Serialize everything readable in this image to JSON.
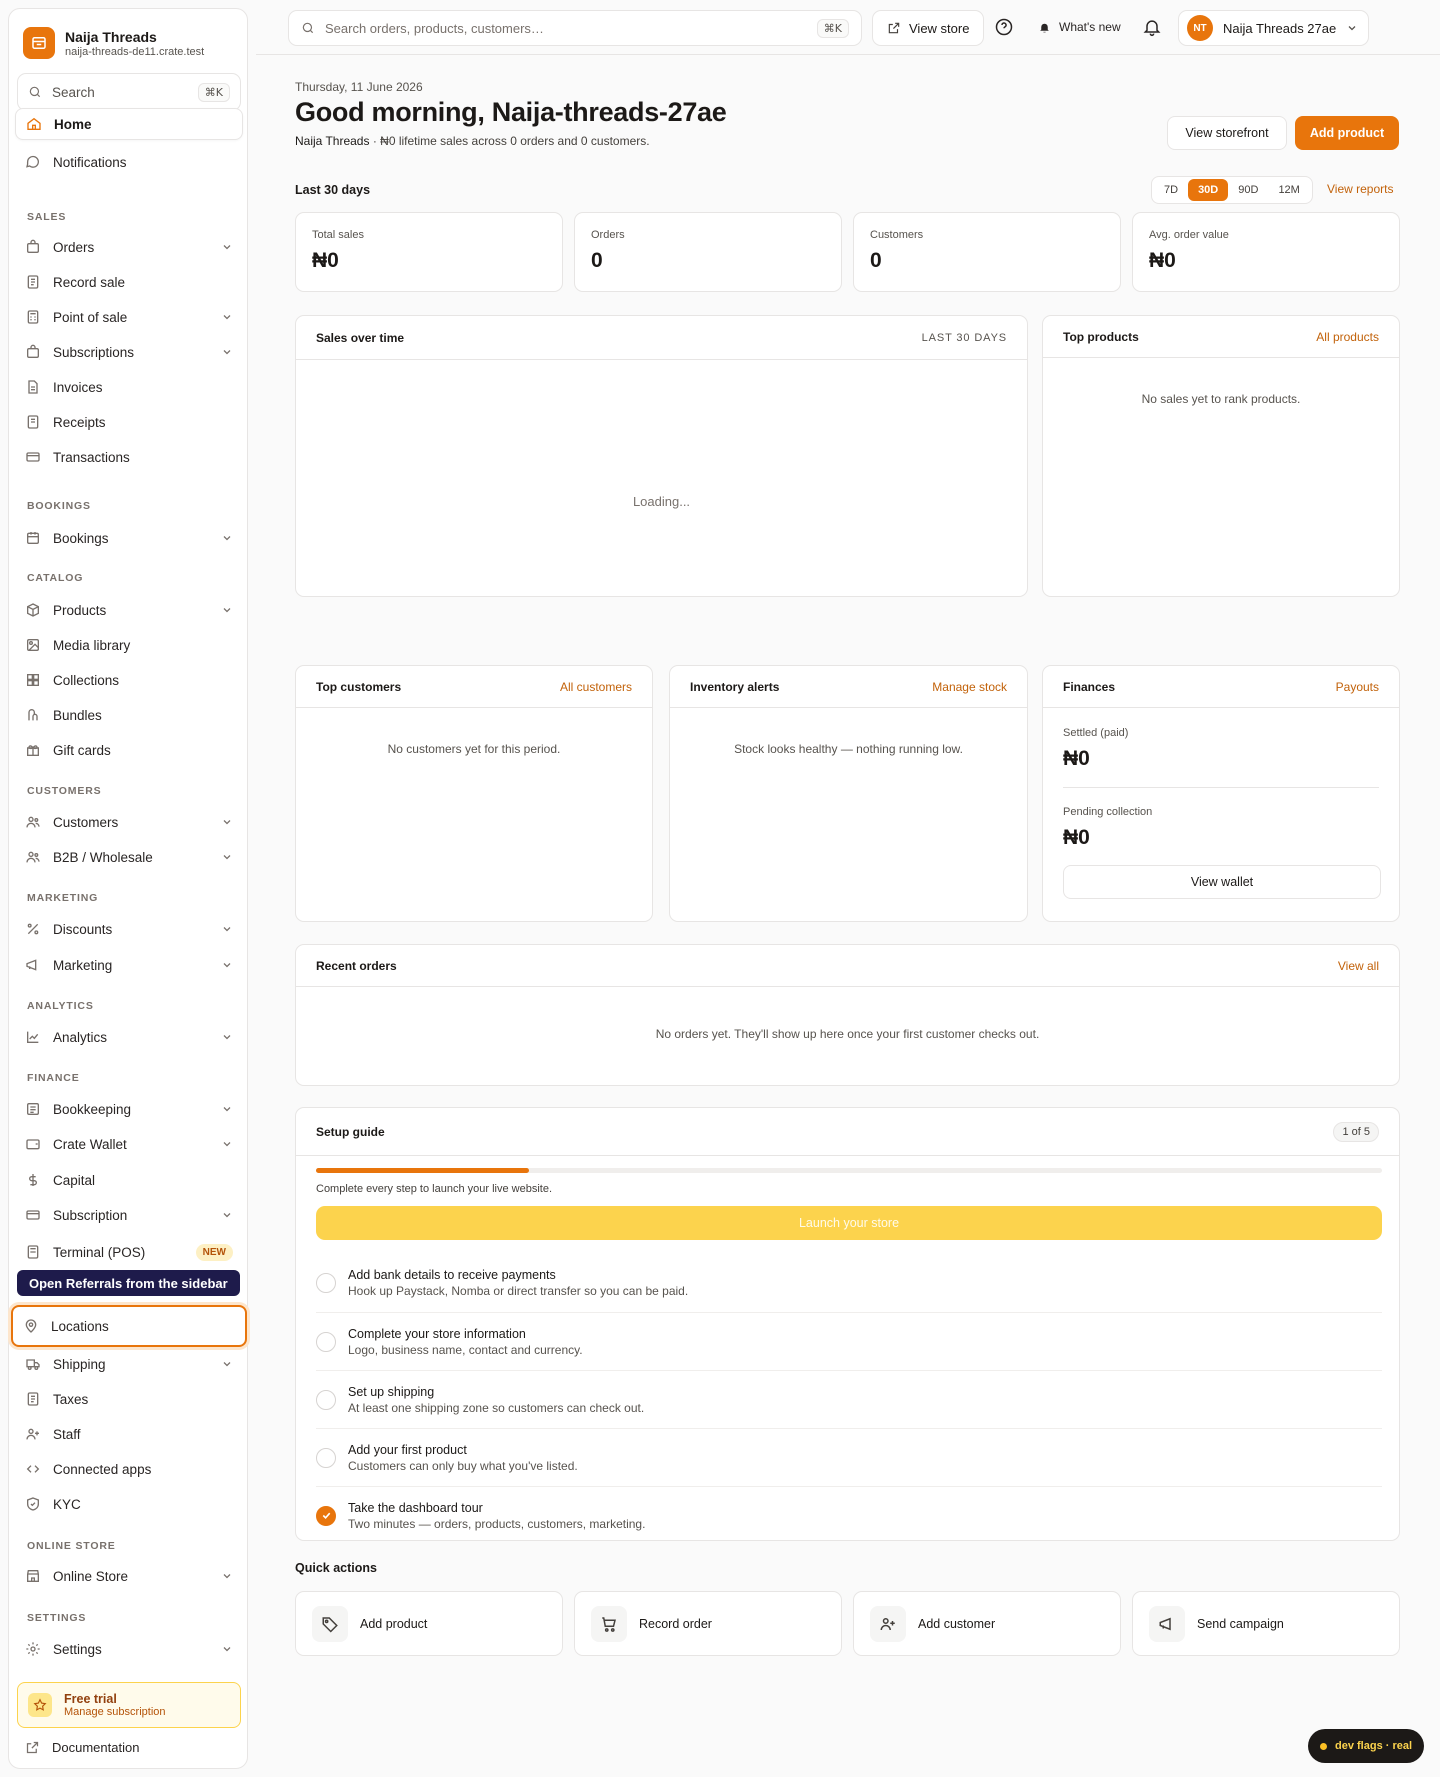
{
  "brand": {
    "name": "Naija Threads",
    "domain": "naija-threads-de11.crate.test"
  },
  "sidebar": {
    "search_label": "Search",
    "search_kbd": "⌘K",
    "home": "Home",
    "notifications": "Notifications",
    "sections": {
      "sales": "SALES",
      "bookings": "BOOKINGS",
      "catalog": "CATALOG",
      "customers": "CUSTOMERS",
      "marketing": "MARKETING",
      "analytics": "ANALYTICS",
      "finance": "FINANCE",
      "online_store": "ONLINE STORE",
      "settings": "SETTINGS"
    },
    "items": {
      "orders": "Orders",
      "record_sale": "Record sale",
      "pos": "Point of sale",
      "subscriptions": "Subscriptions",
      "invoices": "Invoices",
      "receipts": "Receipts",
      "transactions": "Transactions",
      "bookings": "Bookings",
      "products": "Products",
      "media": "Media library",
      "collections": "Collections",
      "bundles": "Bundles",
      "gift_cards": "Gift cards",
      "customers": "Customers",
      "b2b": "B2B / Wholesale",
      "discounts": "Discounts",
      "marketing": "Marketing",
      "analytics": "Analytics",
      "bookkeeping": "Bookkeeping",
      "wallet": "Crate Wallet",
      "capital": "Capital",
      "subscription": "Subscription",
      "terminal": "Terminal (POS)",
      "terminal_badge": "NEW",
      "locations": "Locations",
      "shipping": "Shipping",
      "taxes": "Taxes",
      "staff": "Staff",
      "connected_apps": "Connected apps",
      "kyc": "KYC",
      "online_store": "Online Store",
      "settings": "Settings"
    },
    "tooltip": "Open Referrals from the sidebar",
    "trial": {
      "title": "Free trial",
      "subtitle": "Manage subscription"
    },
    "documentation": "Documentation"
  },
  "topbar": {
    "search_placeholder": "Search orders, products, customers…",
    "search_kbd": "⌘K",
    "view_store": "View store",
    "whats_new": "What's new",
    "account_initials": "NT",
    "account_name": "Naija Threads 27ae"
  },
  "page": {
    "date": "Thursday, 11 June 2026",
    "greeting": "Good morning, Naija-threads-27ae",
    "summary_store": "Naija Threads",
    "summary_rest": " · ₦0 lifetime sales across 0 orders and 0 customers.",
    "view_storefront": "View storefront",
    "add_product": "Add product",
    "period_label": "Last 30 days",
    "ranges": [
      "7D",
      "30D",
      "90D",
      "12M"
    ],
    "active_range": "30D",
    "view_reports": "View reports"
  },
  "kpis": [
    {
      "label": "Total sales",
      "value": "₦0"
    },
    {
      "label": "Orders",
      "value": "0"
    },
    {
      "label": "Customers",
      "value": "0"
    },
    {
      "label": "Avg. order value",
      "value": "₦0"
    }
  ],
  "sales_over_time": {
    "title": "Sales over time",
    "range": "LAST 30 DAYS",
    "status": "Loading..."
  },
  "top_products": {
    "title": "Top products",
    "link": "All products",
    "empty": "No sales yet to rank products."
  },
  "top_customers": {
    "title": "Top customers",
    "link": "All customers",
    "empty": "No customers yet for this period."
  },
  "inventory": {
    "title": "Inventory alerts",
    "link": "Manage stock",
    "empty": "Stock looks healthy — nothing running low."
  },
  "finances": {
    "title": "Finances",
    "link": "Payouts",
    "settled_label": "Settled (paid)",
    "settled_value": "₦0",
    "pending_label": "Pending collection",
    "pending_value": "₦0",
    "wallet_button": "View wallet"
  },
  "recent_orders": {
    "title": "Recent orders",
    "link": "View all",
    "empty": "No orders yet. They'll show up here once your first customer checks out."
  },
  "setup": {
    "title": "Setup guide",
    "counter": "1 of 5",
    "progress": 0.2,
    "hint": "Complete every step to launch your live website.",
    "launch": "Launch your store",
    "steps": [
      {
        "title": "Add bank details to receive payments",
        "desc": "Hook up Paystack, Nomba or direct transfer so you can be paid.",
        "done": false
      },
      {
        "title": "Complete your store information",
        "desc": "Logo, business name, contact and currency.",
        "done": false
      },
      {
        "title": "Set up shipping",
        "desc": "At least one shipping zone so customers can check out.",
        "done": false
      },
      {
        "title": "Add your first product",
        "desc": "Customers can only buy what you've listed.",
        "done": false
      },
      {
        "title": "Take the dashboard tour",
        "desc": "Two minutes — orders, products, customers, marketing.",
        "done": true
      }
    ]
  },
  "quick_actions": {
    "title": "Quick actions",
    "items": [
      "Add product",
      "Record order",
      "Add customer",
      "Send campaign"
    ]
  },
  "dev_flags": "dev flags · real",
  "colors": {
    "accent": "#e8750c",
    "launch": "#fcd34d",
    "tooltip": "#1e1b4b"
  }
}
